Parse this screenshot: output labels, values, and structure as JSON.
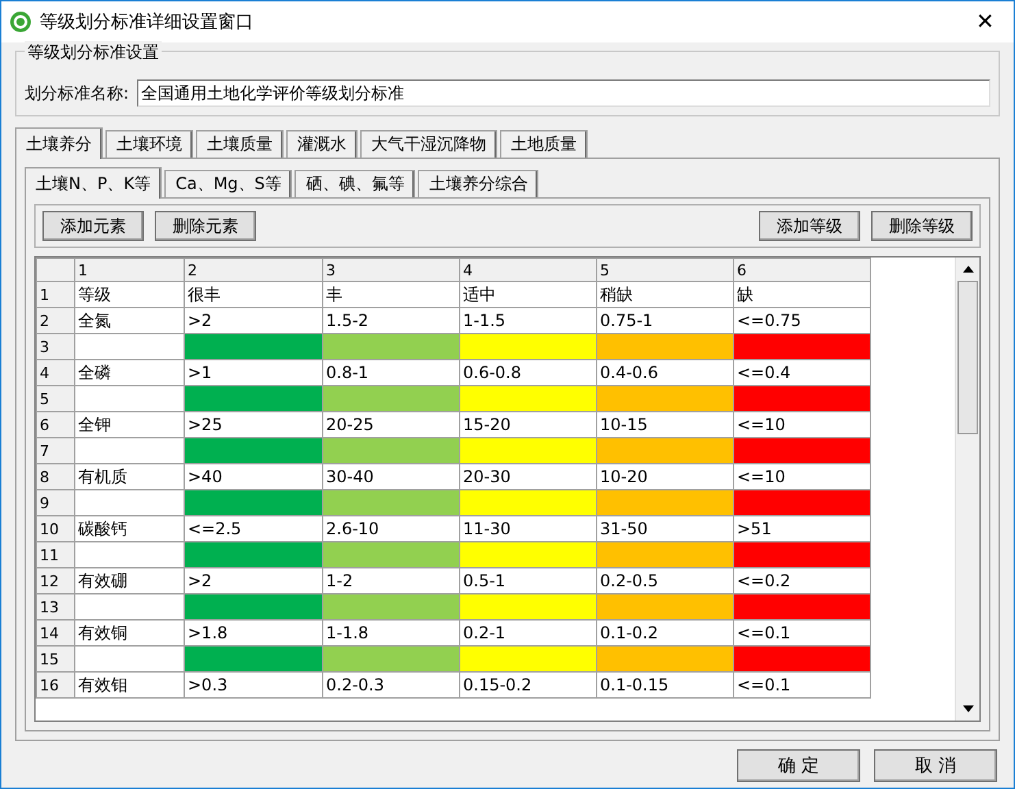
{
  "window": {
    "title": "等级划分标准详细设置窗口",
    "close": "✕"
  },
  "group": {
    "title": "等级划分标准设置",
    "label": "划分标准名称:",
    "value": "全国通用土地化学评价等级划分标准"
  },
  "tabs": [
    {
      "label": "土壤养分",
      "selected": true
    },
    {
      "label": "土壤环境",
      "selected": false
    },
    {
      "label": "土壤质量",
      "selected": false
    },
    {
      "label": "灌溉水",
      "selected": false
    },
    {
      "label": "大气干湿沉降物",
      "selected": false
    },
    {
      "label": "土地质量",
      "selected": false
    }
  ],
  "subtabs": [
    {
      "label": "土壤N、P、K等",
      "selected": true
    },
    {
      "label": "Ca、Mg、S等",
      "selected": false
    },
    {
      "label": "硒、碘、氟等",
      "selected": false
    },
    {
      "label": "土壤养分综合",
      "selected": false
    }
  ],
  "toolbar_left": [
    "添加元素",
    "删除元素"
  ],
  "toolbar_right": [
    "添加等级",
    "删除等级"
  ],
  "grid": {
    "columns": [
      "1",
      "2",
      "3",
      "4",
      "5",
      "6"
    ],
    "rows": [
      {
        "number": "1",
        "kind": "text",
        "cells": [
          "等级",
          "很丰",
          "丰",
          "适中",
          "稍缺",
          "缺"
        ]
      },
      {
        "number": "2",
        "kind": "text",
        "cells": [
          "全氮",
          ">2",
          "1.5-2",
          "1-1.5",
          "0.75-1",
          "<=0.75"
        ]
      },
      {
        "number": "3",
        "kind": "swatch",
        "swatches": [
          {
            "color": "#00b050"
          },
          {
            "color": "#92d050"
          },
          {
            "color": "#ffff00"
          },
          {
            "color": "#ffc000"
          },
          {
            "color": "#ff0000"
          }
        ]
      },
      {
        "number": "4",
        "kind": "text",
        "cells": [
          "全磷",
          ">1",
          "0.8-1",
          "0.6-0.8",
          "0.4-0.6",
          "<=0.4"
        ]
      },
      {
        "number": "5",
        "kind": "swatch",
        "swatches": [
          {
            "color": "#00b050"
          },
          {
            "color": "#92d050"
          },
          {
            "color": "#ffff00"
          },
          {
            "color": "#ffc000"
          },
          {
            "color": "#ff0000"
          }
        ]
      },
      {
        "number": "6",
        "kind": "text",
        "cells": [
          "全钾",
          ">25",
          "20-25",
          "15-20",
          "10-15",
          "<=10"
        ]
      },
      {
        "number": "7",
        "kind": "swatch",
        "swatches": [
          {
            "color": "#00b050"
          },
          {
            "color": "#92d050"
          },
          {
            "color": "#ffff00"
          },
          {
            "color": "#ffc000"
          },
          {
            "color": "#ff0000"
          }
        ]
      },
      {
        "number": "8",
        "kind": "text",
        "cells": [
          "有机质",
          ">40",
          "30-40",
          "20-30",
          "10-20",
          "<=10"
        ]
      },
      {
        "number": "9",
        "kind": "swatch",
        "swatches": [
          {
            "color": "#00b050"
          },
          {
            "color": "#92d050"
          },
          {
            "color": "#ffff00"
          },
          {
            "color": "#ffc000"
          },
          {
            "color": "#ff0000"
          }
        ]
      },
      {
        "number": "10",
        "kind": "text",
        "cells": [
          "碳酸钙",
          "<=2.5",
          "2.6-10",
          "11-30",
          "31-50",
          ">51"
        ]
      },
      {
        "number": "11",
        "kind": "swatch",
        "swatches": [
          {
            "color": "#00b050"
          },
          {
            "color": "#92d050"
          },
          {
            "color": "#ffff00"
          },
          {
            "color": "#ffc000"
          },
          {
            "color": "#ff0000"
          }
        ]
      },
      {
        "number": "12",
        "kind": "text",
        "cells": [
          "有效硼",
          ">2",
          "1-2",
          "0.5-1",
          "0.2-0.5",
          "<=0.2"
        ]
      },
      {
        "number": "13",
        "kind": "swatch",
        "swatches": [
          {
            "color": "#00b050"
          },
          {
            "color": "#92d050"
          },
          {
            "color": "#ffff00"
          },
          {
            "color": "#ffc000"
          },
          {
            "color": "#ff0000"
          }
        ]
      },
      {
        "number": "14",
        "kind": "text",
        "cells": [
          "有效铜",
          ">1.8",
          "1-1.8",
          "0.2-1",
          "0.1-0.2",
          "<=0.1"
        ]
      },
      {
        "number": "15",
        "kind": "swatch",
        "swatches": [
          {
            "color": "#00b050"
          },
          {
            "color": "#92d050"
          },
          {
            "color": "#ffff00"
          },
          {
            "color": "#ffc000"
          },
          {
            "color": "#ff0000"
          }
        ]
      },
      {
        "number": "16",
        "kind": "text",
        "cells": [
          "有效钼",
          ">0.3",
          "0.2-0.3",
          "0.15-0.2",
          "0.1-0.15",
          "<=0.1"
        ]
      }
    ]
  },
  "buttons": [
    "确 定",
    "取 消"
  ]
}
